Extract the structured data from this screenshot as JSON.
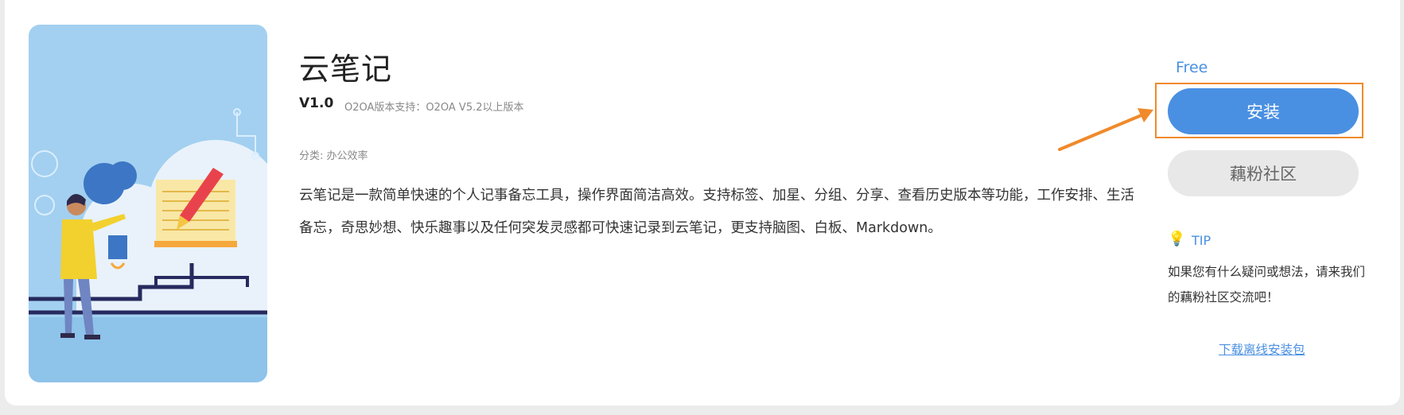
{
  "app": {
    "title": "云笔记",
    "version": "V1.0",
    "support": "O2OA版本支持：O2OA V5.2以上版本",
    "category": "分类: 办公效率",
    "description": "云笔记是一款简单快速的个人记事备忘工具，操作界面简洁高效。支持标签、加星、分组、分享、查看历史版本等功能，工作安排、生活备忘，奇思妙想、快乐趣事以及任何突发灵感都可快速记录到云笔记，更支持脑图、白板、Markdown。"
  },
  "sidebar": {
    "price": "Free",
    "install_label": "安装",
    "community_label": "藕粉社区",
    "tip_label": "TIP",
    "tip_text": "如果您有什么疑问或想法，请来我们的藕粉社区交流吧！",
    "download_label": "下载离线安装包"
  },
  "colors": {
    "accent": "#4a90e2",
    "highlight": "#f08a2b",
    "cover_bg": "#a3d0f0"
  }
}
